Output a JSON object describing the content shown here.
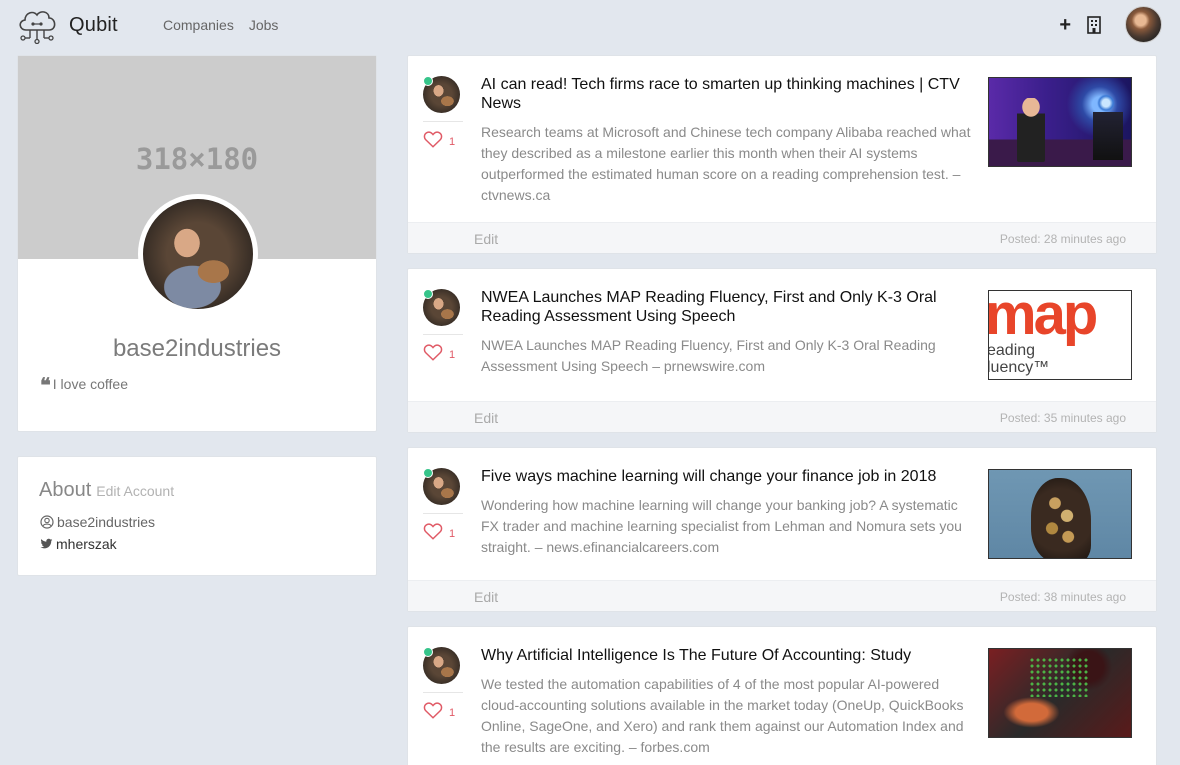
{
  "navbar": {
    "brand": "Qubit",
    "links": [
      "Companies",
      "Jobs"
    ],
    "add_icon": "plus-icon",
    "company_icon": "building-icon"
  },
  "profile": {
    "cover_placeholder": "318×180",
    "name": "base2industries",
    "quote": "I love coffee"
  },
  "about": {
    "title": "About",
    "edit_label": "Edit Account",
    "username": "base2industries",
    "twitter": "mherszak"
  },
  "posts": [
    {
      "title": "AI can read! Tech firms race to smarten up thinking machines | CTV News",
      "description": "Research teams at Microsoft and Chinese tech company Alibaba reached what they described as a milestone earlier this month when their AI systems outperformed the estimated human score on a reading comprehension test. – ctvnews.ca",
      "likes": "1",
      "edit_label": "Edit",
      "posted": "Posted: 28 minutes ago"
    },
    {
      "title": "NWEA Launches MAP Reading Fluency, First and Only K-3 Oral Reading Assessment Using Speech",
      "description": "NWEA Launches MAP Reading Fluency, First and Only K-3 Oral Reading Assessment Using Speech – prnewswire.com",
      "likes": "1",
      "edit_label": "Edit",
      "posted": "Posted: 35 minutes ago",
      "thumb_text": [
        "map",
        "eading",
        "luency™"
      ]
    },
    {
      "title": "Five ways machine learning will change your finance job in 2018",
      "description": "Wondering how machine learning will change your banking job? A systematic FX trader and machine learning specialist from Lehman and Nomura sets you straight. – news.efinancialcareers.com",
      "likes": "1",
      "edit_label": "Edit",
      "posted": "Posted: 38 minutes ago"
    },
    {
      "title": "Why Artificial Intelligence Is The Future Of Accounting: Study",
      "description": "We tested the automation capabilities of 4 of the most popular AI-powered cloud-accounting solutions available in the market today (OneUp, QuickBooks Online, SageOne, and Xero) and rank them against our Automation Index and the results are exciting. – forbes.com",
      "likes": "1"
    }
  ],
  "colors": {
    "page_bg": "#e2e7ee",
    "online": "#36c48a",
    "like": "#e05a66"
  }
}
